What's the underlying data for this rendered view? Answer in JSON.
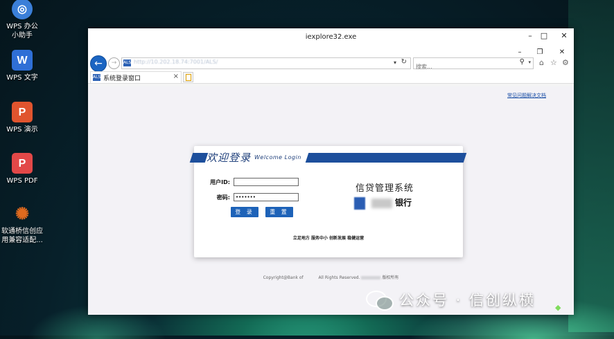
{
  "desktop": {
    "icons": [
      {
        "name": "WPS 办公\n小助手",
        "icon": "wps-assistant-icon",
        "color": "#3b7fd8"
      },
      {
        "name": "WPS 文字",
        "icon": "wps-writer-icon",
        "color": "#2f6fd6"
      },
      {
        "name": "WPS 演示",
        "icon": "wps-presentation-icon",
        "color": "#e0542e"
      },
      {
        "name": "WPS PDF",
        "icon": "wps-pdf-icon",
        "color": "#e24848"
      },
      {
        "name": "软通桥信创应\n用兼容适配...",
        "icon": "isoftstone-bridge-icon",
        "color": "#e06a1e"
      }
    ]
  },
  "window": {
    "title": "iexplore32.exe",
    "controls": {
      "minimize": "–",
      "maximize": "□",
      "close": "✕"
    },
    "ie_controls": {
      "minimize": "–",
      "restore": "❐",
      "close": "✕"
    }
  },
  "browser": {
    "address": "http://10.202.18.74:7001/ALS/",
    "search_placeholder": "搜索...",
    "tab_label": "系统登录窗口",
    "tab_close": "×"
  },
  "page": {
    "faq_link": "常见问题解决文档",
    "welcome_cn": "欢迎登录",
    "welcome_en": "Welcome Login",
    "user_label": "用户ID:",
    "user_value": "",
    "password_label": "密码:",
    "password_value": "•••••••",
    "login_button": "登 录",
    "reset_button": "重 置",
    "system_name": "信贷管理系统",
    "bank_suffix": "银行",
    "slogan": "立足地方  服务中小  创新发展  稳健运营",
    "copyright_left": "Copyright@Bank of",
    "copyright_mid": "All Rights Reserved.",
    "copyright_right": "版权所有"
  },
  "watermark": {
    "text": "公众号 · 信创纵横"
  },
  "colors": {
    "ie_blue": "#1b65c2",
    "banner_blue": "#1d4f9c",
    "button_blue": "#1d62b8"
  }
}
